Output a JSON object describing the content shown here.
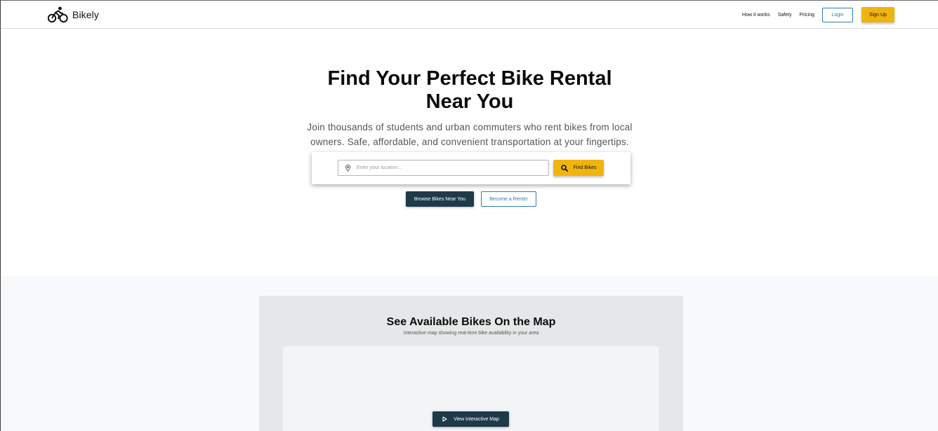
{
  "header": {
    "brand": "Bikely",
    "logo_icon": "bicycle-rider-icon",
    "nav": [
      "How it works",
      "Safety",
      "Pricing"
    ],
    "login_label": "Login",
    "signup_label": "Sign Up"
  },
  "hero": {
    "title_line1": "Find Your Perfect Bike Rental",
    "title_line2": "Near You",
    "subtitle_line1": "Join thousands of students and urban commuters who rent bikes from local",
    "subtitle_line2": "owners. Safe, affordable, and convenient transportation at your fingertips.",
    "search_placeholder": "Enter your location...",
    "search_icon": "map-pin-icon",
    "find_label": "Find Bikes",
    "find_icon": "search-icon",
    "browse_label": "Browse Bikes Near You",
    "renter_label": "Become a Renter"
  },
  "map": {
    "title": "See Available Bikes On the Map",
    "subtitle": "Interactive map showing real-time bike availability in your area",
    "button_label": "View Interactive Map",
    "button_icon": "play-icon"
  },
  "colors": {
    "accent": "#f0b40f",
    "primary_dark": "#1f3a4a",
    "link_blue": "#2e7fa8"
  }
}
